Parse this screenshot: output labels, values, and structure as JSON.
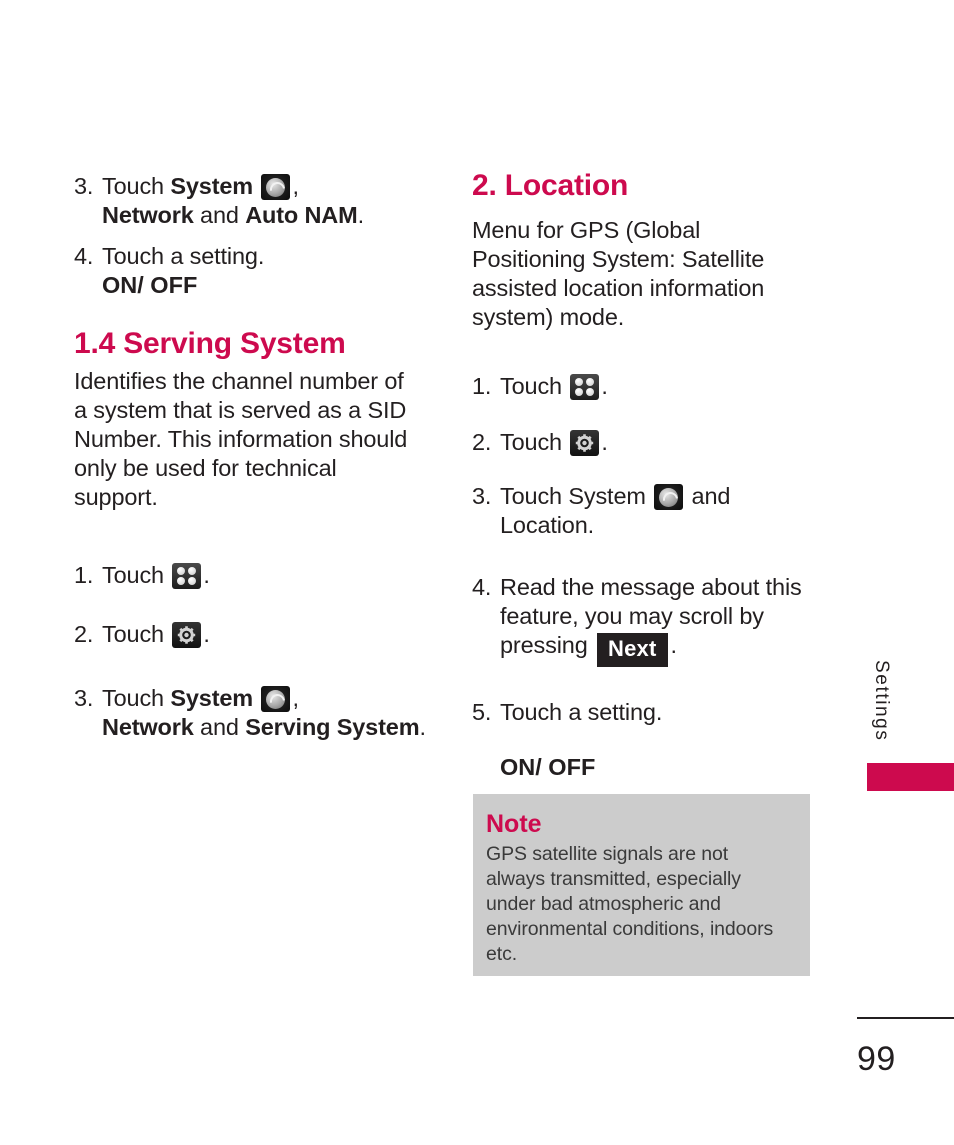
{
  "document": {
    "page_number": "99",
    "side_tab_label": "Settings",
    "accent_color": "#cd0a4e",
    "note_bg_color": "#cccccc"
  },
  "left_column": {
    "step3": {
      "num": "3.",
      "text_before": "Touch ",
      "bold1": "System",
      "icon": "system-icon",
      "comma": ",",
      "line2_bold1": "Network",
      "line2_mid": " and ",
      "line2_bold2": "Auto NAM",
      "line2_end": "."
    },
    "step4": {
      "num": "4.",
      "text": "Touch a setting.",
      "value": "ON/ OFF"
    },
    "heading": "1.4 Serving System",
    "paragraph": "Identifies the channel number of a system that is served as a SID Number. This information should only be used for technical support.",
    "steps": [
      {
        "num": "1.",
        "text_before": "Touch ",
        "icon": "menu-grid-icon",
        "text_after": "."
      },
      {
        "num": "2.",
        "text_before": "Touch ",
        "icon": "settings-gear-icon",
        "text_after": "."
      },
      {
        "num": "3.",
        "text_before": "Touch ",
        "bold1": "System",
        "icon": "system-icon",
        "comma": ",",
        "line2_bold1": "Network",
        "line2_mid": " and ",
        "line2_bold2": "Serving System",
        "line2_end": "."
      }
    ]
  },
  "right_column": {
    "heading": "2. Location",
    "paragraph": "Menu for GPS (Global Positioning System: Satellite assisted location information system) mode.",
    "steps": [
      {
        "num": "1.",
        "text_before": "Touch ",
        "icon": "menu-grid-icon",
        "text_after": "."
      },
      {
        "num": "2.",
        "text_before": "Touch ",
        "icon": "settings-gear-icon",
        "text_after": "."
      },
      {
        "num": "3.",
        "text_before": "Touch System ",
        "icon": "system-icon",
        "text_after": " and",
        "line2": "Location."
      },
      {
        "num": "4.",
        "text_before": "Read the message about this feature, you may scroll by pressing ",
        "key_label": "Next",
        "text_after": "."
      },
      {
        "num": "5.",
        "text": "Touch a setting.",
        "value": "ON/ OFF"
      }
    ],
    "note": {
      "title": "Note",
      "body": "GPS satellite signals are not always transmitted, especially under bad atmospheric and environmental conditions, indoors etc."
    }
  }
}
